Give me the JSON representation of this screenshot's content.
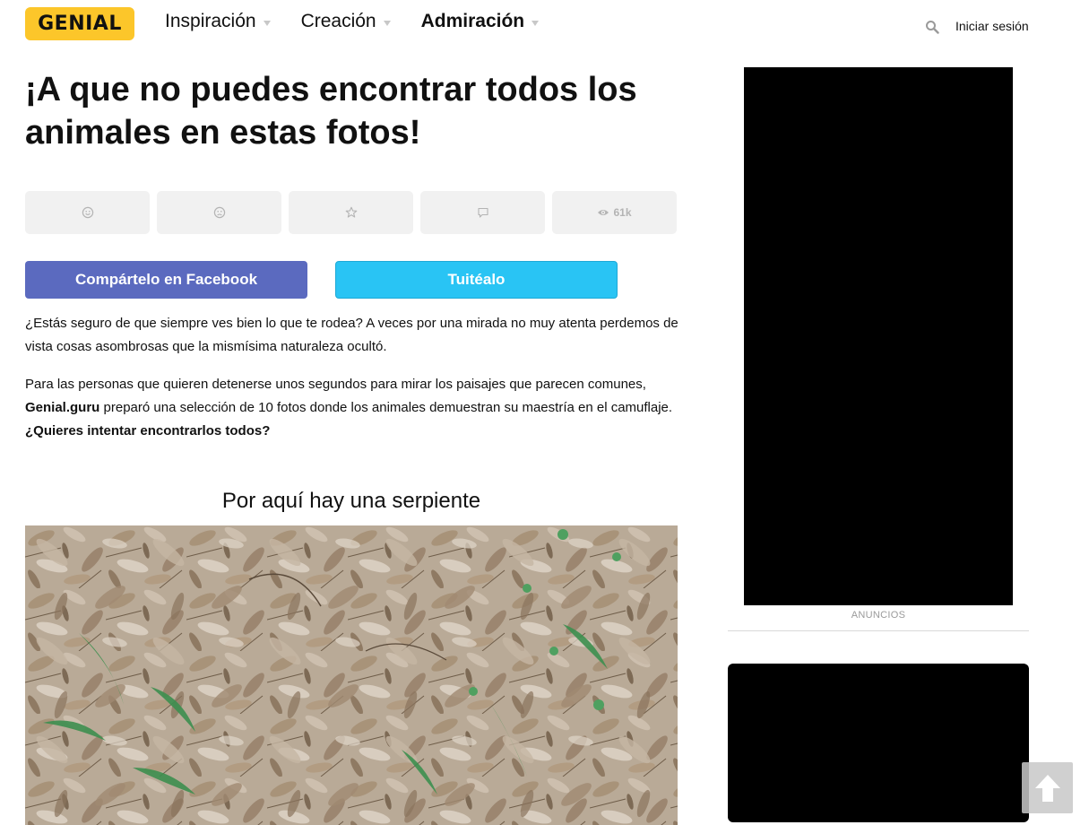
{
  "header": {
    "logo": "GENIAL",
    "nav": [
      {
        "label": "Inspiración",
        "bold": false
      },
      {
        "label": "Creación",
        "bold": false
      },
      {
        "label": "Admiración",
        "bold": true
      }
    ],
    "login": "Iniciar sesión"
  },
  "article": {
    "title": "¡A que no puedes encontrar todos los animales en estas fotos!",
    "reactions": [
      {
        "icon": "smile-icon"
      },
      {
        "icon": "sad-icon"
      },
      {
        "icon": "star-icon"
      },
      {
        "icon": "comment-icon"
      },
      {
        "icon": "eye-icon",
        "count": "61k"
      }
    ],
    "share_facebook": "Compártelo en Facebook",
    "share_twitter": "Tuitéalo",
    "paragraph1": "¿Estás seguro de que siempre ves bien lo que te rodea? A veces por una mirada no muy atenta perdemos de vista cosas asombrosas que la mismísima naturaleza ocultó.",
    "paragraph2": {
      "part1": "Para las personas que quieren detenerse unos segundos para mirar los paisajes que parecen comunes, ",
      "brand": "Genial.guru",
      "part2": " preparó una selección de 10 fotos donde los animales demuestran su maestría en el camuflaje. ",
      "question": "¿Quieres intentar encontrarlos todos?"
    },
    "subtitle": "Por aquí hay una serpiente"
  },
  "sidebar": {
    "ad_label": "ANUNCIOS"
  },
  "colors": {
    "brand_yellow": "#fcc62a",
    "facebook": "#5b6abf",
    "twitter": "#29c4f4",
    "reaction_bg": "#f1f1f1",
    "ad_bg": "#000000"
  }
}
